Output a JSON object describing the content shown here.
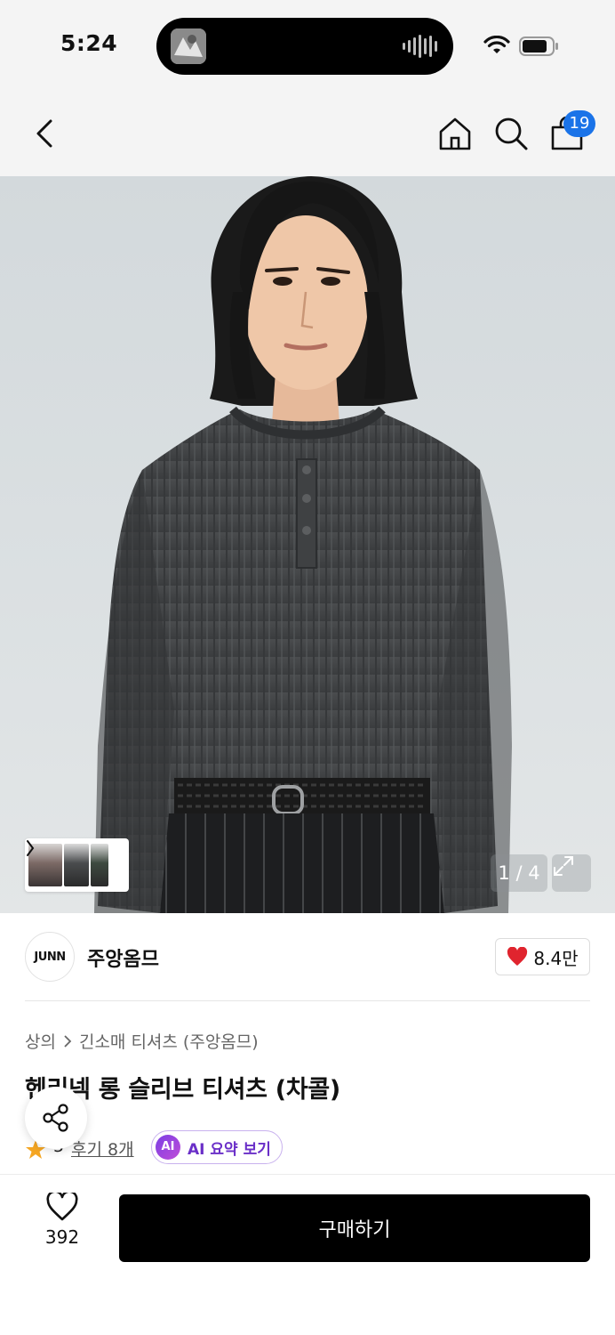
{
  "status_bar": {
    "time": "5:24"
  },
  "navbar": {
    "back_icon": "chevron-left-icon",
    "home_icon": "home-icon",
    "search_icon": "search-icon",
    "cart_icon": "shopping-bag-icon",
    "cart_count": "19"
  },
  "gallery": {
    "page_indicator": "1 / 4",
    "expand_icon": "expand-icon"
  },
  "brand": {
    "logo_text": "JUNN",
    "name": "주앙옴므",
    "likes": "8.4만"
  },
  "product": {
    "breadcrumb": {
      "category": "상의",
      "subcategory": "긴소매 티셔츠 (주앙옴므)"
    },
    "title": "헨리넥 롱 슬리브 티셔츠 (차콜)",
    "rating": "5",
    "review_link": "후기 8개",
    "ai_badge": "AI",
    "ai_summary_label": "AI 요약 보기"
  },
  "bottom_bar": {
    "wish_count": "392",
    "buy_label": "구매하기"
  },
  "colors": {
    "accent_blue": "#1a73e8",
    "buy_button": "#000000",
    "heart_red": "#e0242e",
    "star_orange": "#f5a623",
    "ai_purple": "#6a2fc8"
  }
}
